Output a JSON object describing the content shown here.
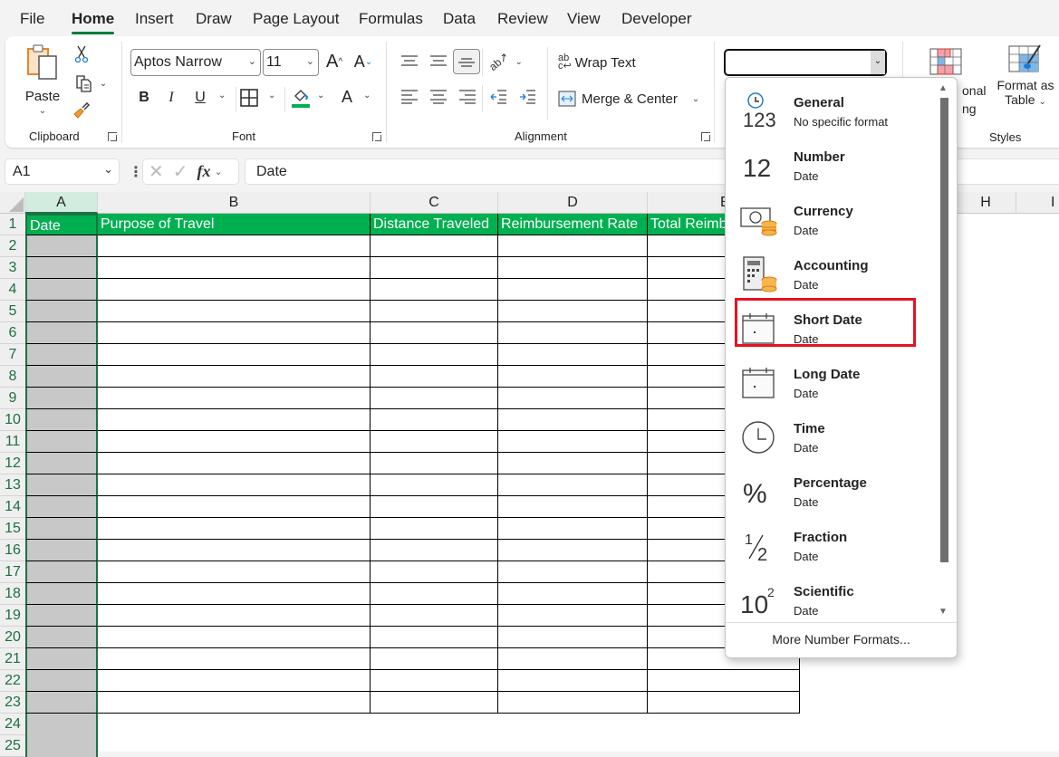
{
  "tabs": [
    "File",
    "Home",
    "Insert",
    "Draw",
    "Page Layout",
    "Formulas",
    "Data",
    "Review",
    "View",
    "Developer"
  ],
  "active_tab": "Home",
  "ribbon": {
    "clipboard": {
      "paste_label": "Paste",
      "group_label": "Clipboard"
    },
    "font": {
      "font_name": "Aptos Narrow",
      "font_size": "11",
      "group_label": "Font",
      "bold": "B",
      "italic": "I",
      "underline": "U",
      "increase": "A",
      "decrease": "A",
      "font_color": "A"
    },
    "alignment": {
      "wrap_text": "Wrap Text",
      "merge_center": "Merge & Center",
      "group_label": "Alignment"
    },
    "number": {
      "format_value": ""
    },
    "styles": {
      "conditional_partial_1": "onal",
      "conditional_partial_2": "ng",
      "format_as_table_1": "Format as",
      "format_as_table_2": "Table",
      "group_label": "Styles"
    }
  },
  "formula_bar": {
    "name_box": "A1",
    "fx": "fx",
    "content": "Date"
  },
  "columns": [
    {
      "id": "A",
      "label": "A"
    },
    {
      "id": "B",
      "label": "B"
    },
    {
      "id": "C",
      "label": "C"
    },
    {
      "id": "D",
      "label": "D"
    },
    {
      "id": "E",
      "label": "E"
    },
    {
      "id": "H",
      "label": "H"
    },
    {
      "id": "I",
      "label": "I"
    }
  ],
  "rows": [
    "1",
    "2",
    "3",
    "4",
    "5",
    "6",
    "7",
    "8",
    "9",
    "10",
    "11",
    "12",
    "13",
    "14",
    "15",
    "16",
    "17",
    "18",
    "19",
    "20",
    "21",
    "22",
    "23",
    "24",
    "25"
  ],
  "table_headers": [
    "Date",
    "Purpose of Travel",
    "Distance Traveled",
    "Reimbursement Rate",
    "Total Reimb"
  ],
  "number_format_menu": {
    "items": [
      {
        "icon": "general-clock-123-icon",
        "title": "General",
        "sub": "No specific format"
      },
      {
        "icon": "number-12-icon",
        "title": "Number",
        "sub": "Date"
      },
      {
        "icon": "currency-icon",
        "title": "Currency",
        "sub": "Date"
      },
      {
        "icon": "accounting-icon",
        "title": "Accounting",
        "sub": "Date"
      },
      {
        "icon": "calendar-icon",
        "title": "Short Date",
        "sub": "Date",
        "highlighted": true
      },
      {
        "icon": "calendar-icon",
        "title": "Long Date",
        "sub": "Date"
      },
      {
        "icon": "clock-icon",
        "title": "Time",
        "sub": "Date"
      },
      {
        "icon": "percent-icon",
        "title": "Percentage",
        "sub": "Date"
      },
      {
        "icon": "fraction-icon",
        "title": "Fraction",
        "sub": "Date"
      },
      {
        "icon": "scientific-icon",
        "title": "Scientific",
        "sub": "Date"
      }
    ],
    "more": "More Number Formats..."
  },
  "colors": {
    "header_green": "#00b050",
    "highlight_red": "#e81123",
    "selection_green": "#1e7145"
  }
}
